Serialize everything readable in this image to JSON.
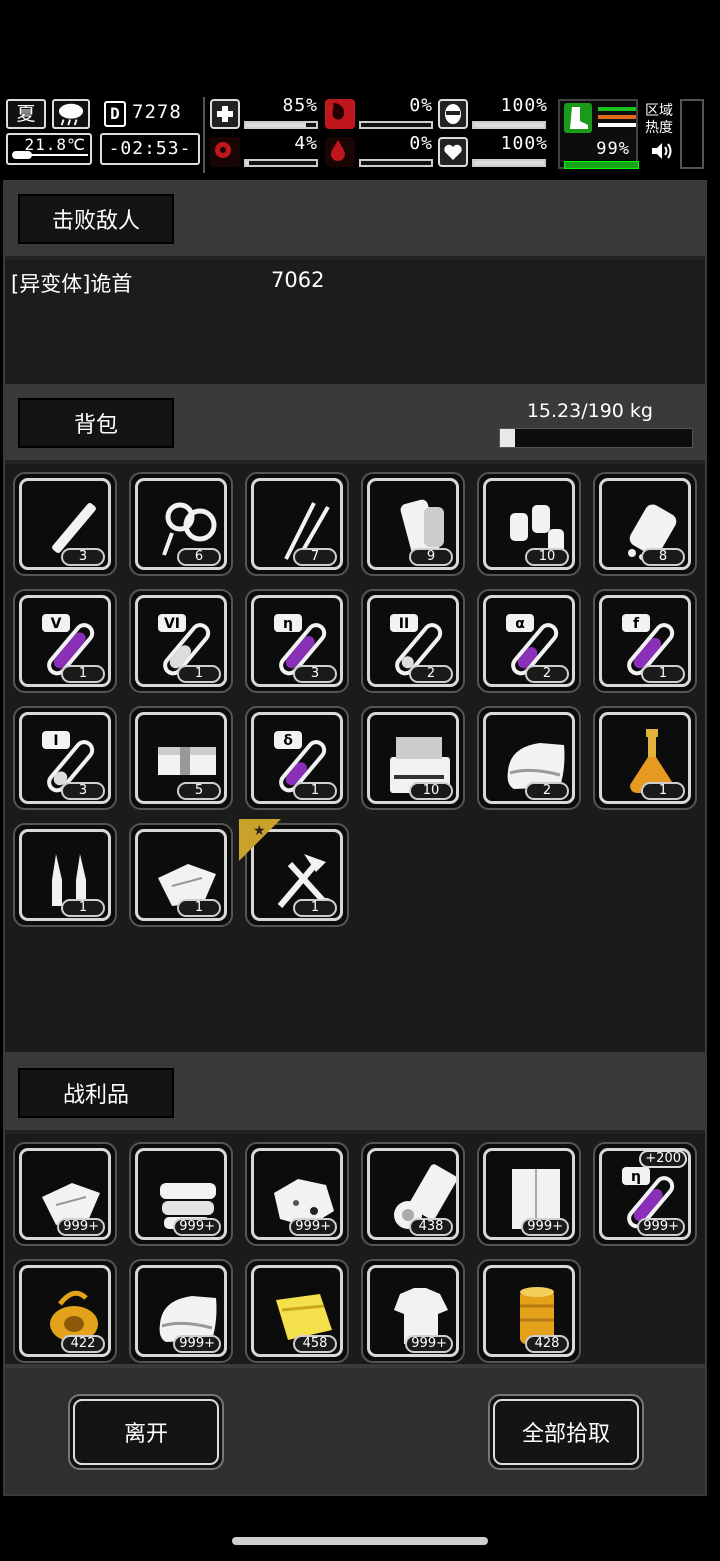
{
  "hud": {
    "season": "夏",
    "temperature": "21.8℃",
    "day": "7278",
    "time": "-02:53-",
    "stats": {
      "health_pct": "85%",
      "stomach_pct": "0%",
      "mind_pct": "100%",
      "infection_pct": "4%",
      "blood_pct": "0%",
      "heart_pct": "100%",
      "stamina_pct": "99%"
    },
    "stat_levels": {
      "health": 0.85,
      "stomach": 0,
      "mind": 1.0,
      "infection": 0.04,
      "blood": 0,
      "heart": 1.0,
      "stamina": 0.99
    },
    "zone_label_1": "区域",
    "zone_label_2": "热度",
    "colors": {
      "health_red": "#c0171c",
      "walk_green": "#1a9a1a",
      "stripe_orange": "#e06a1a"
    }
  },
  "defeated": {
    "tab_label": "击败敌人",
    "enemy_name": "[异变体]诡首",
    "enemy_count": "7062"
  },
  "backpack": {
    "tab_label": "背包",
    "weight_text": "15.23/190 kg",
    "weight_level": 0.08,
    "items": [
      {
        "icon": "cigarette-icon",
        "count": "3"
      },
      {
        "icon": "rope-icon",
        "count": "6"
      },
      {
        "icon": "tweezers-icon",
        "count": "7"
      },
      {
        "icon": "scroll-icon",
        "count": "9"
      },
      {
        "icon": "pills-icon",
        "count": "10"
      },
      {
        "icon": "pill-bottle-icon",
        "count": "8"
      },
      {
        "icon": "test-tube-v-icon",
        "label": "V",
        "count": "1"
      },
      {
        "icon": "test-tube-vi-icon",
        "label": "VI",
        "count": "1"
      },
      {
        "icon": "test-tube-eta-icon",
        "label": "η",
        "count": "3"
      },
      {
        "icon": "test-tube-ii-icon",
        "label": "II",
        "count": "2"
      },
      {
        "icon": "test-tube-alpha-icon",
        "label": "α",
        "count": "2"
      },
      {
        "icon": "test-tube-f-icon",
        "label": "f",
        "count": "1"
      },
      {
        "icon": "test-tube-i-icon",
        "label": "I",
        "count": "3"
      },
      {
        "icon": "cash-bundle-icon",
        "count": "5"
      },
      {
        "icon": "test-tube-delta-icon",
        "label": "δ",
        "count": "1"
      },
      {
        "icon": "toolbox-icon",
        "count": "10"
      },
      {
        "icon": "towel-icon",
        "count": "2"
      },
      {
        "icon": "flask-icon",
        "count": "1"
      },
      {
        "icon": "ampoule-icon",
        "count": "1"
      },
      {
        "icon": "cloth-icon",
        "count": "1"
      },
      {
        "icon": "tools-icon",
        "count": "1"
      }
    ]
  },
  "loot": {
    "tab_label": "战利品",
    "items": [
      {
        "icon": "cloth-icon",
        "count": "999+"
      },
      {
        "icon": "folded-cloth-icon",
        "count": "999+"
      },
      {
        "icon": "rag-icon",
        "count": "999+"
      },
      {
        "icon": "bandage-roll-icon",
        "count": "438"
      },
      {
        "icon": "sheet-icon",
        "count": "999+"
      },
      {
        "icon": "test-tube-eta-icon",
        "label": "η",
        "count": "999+",
        "bonus": "+200"
      },
      {
        "icon": "gold-wire-icon",
        "count": "422"
      },
      {
        "icon": "towel-icon",
        "count": "999+"
      },
      {
        "icon": "gold-cloth-icon",
        "count": "458"
      },
      {
        "icon": "shirt-icon",
        "count": "999+"
      },
      {
        "icon": "gold-thread-icon",
        "count": "428"
      }
    ]
  },
  "actions": {
    "leave_label": "离开",
    "take_all_label": "全部拾取"
  }
}
